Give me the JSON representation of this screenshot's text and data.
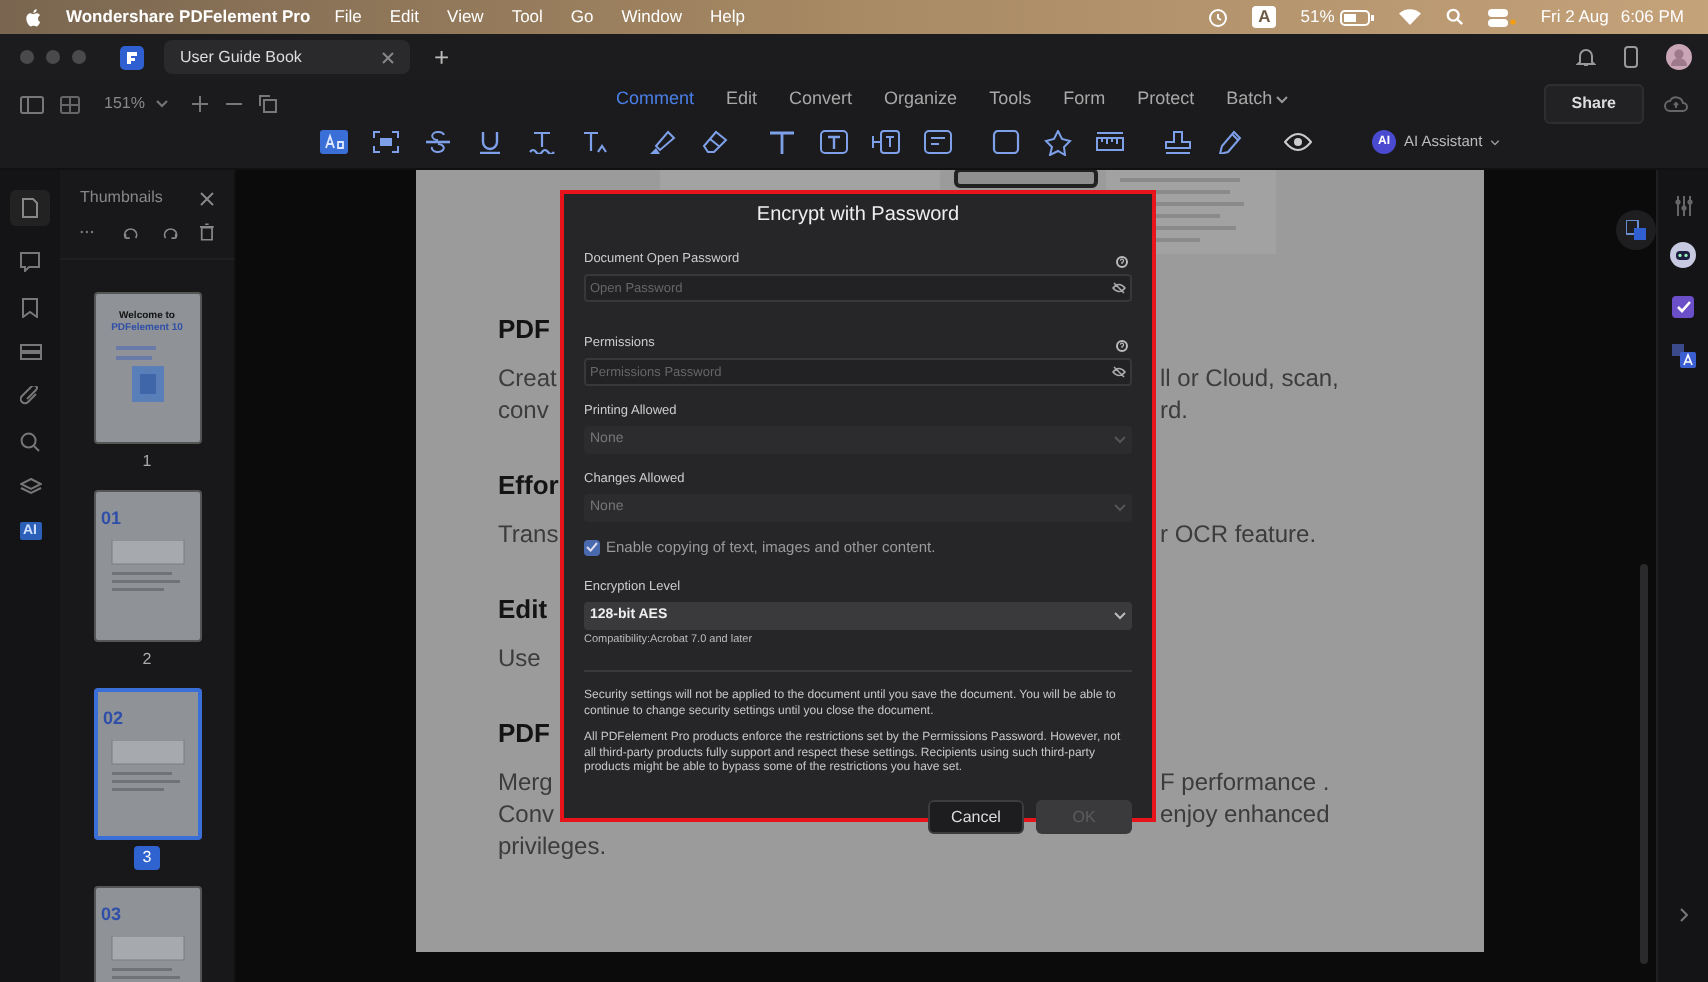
{
  "menu_bar": {
    "app_name": "Wondershare PDFelement Pro",
    "menus": [
      "File",
      "Edit",
      "View",
      "Tool",
      "Go",
      "Window",
      "Help"
    ],
    "input_source": "A",
    "battery": "51%",
    "date": "Fri 2 Aug",
    "time": "6:06 PM"
  },
  "tab_bar": {
    "tabs": [
      {
        "label": "User Guide Book",
        "selected": true
      }
    ],
    "new_tab": "+"
  },
  "toolbar": {
    "zoom": "151%",
    "modes": [
      {
        "label": "Comment",
        "selected": true
      },
      {
        "label": "Edit",
        "selected": false
      },
      {
        "label": "Convert",
        "selected": false
      },
      {
        "label": "Organize",
        "selected": false
      },
      {
        "label": "Tools",
        "selected": false
      },
      {
        "label": "Form",
        "selected": false
      },
      {
        "label": "Protect",
        "selected": false
      },
      {
        "label": "Batch",
        "selected": false
      }
    ],
    "share": "Share",
    "ai_badge": "AI",
    "ai_assistant": "AI Assistant"
  },
  "left_rail": {
    "ai_label": "AI"
  },
  "thumbnails": {
    "title": "Thumbnails",
    "pages": [
      {
        "number": "1",
        "selected": false,
        "lines": [
          "Welcome to",
          "PDFelement 10"
        ]
      },
      {
        "number": "2",
        "selected": false,
        "lines": [
          "01"
        ]
      },
      {
        "number": "3",
        "selected": true,
        "lines": [
          "02"
        ]
      },
      {
        "selected": false,
        "lines": [
          "03"
        ]
      }
    ]
  },
  "document": {
    "sections": [
      {
        "heading": "PDF",
        "lines": [
          {
            "left": "Creat",
            "right": "ll or Cloud, scan,"
          },
          {
            "left": "conv",
            "right": "rd."
          }
        ]
      },
      {
        "heading": "Effor",
        "lines": [
          {
            "left": "Trans",
            "right": "r OCR feature."
          }
        ]
      },
      {
        "heading": "Edit",
        "lines": [
          {
            "left": "Use"
          }
        ]
      },
      {
        "heading": "PDF",
        "lines": [
          {
            "left": "Merg",
            "right": "F performance ."
          },
          {
            "left": "Conv",
            "right": "enjoy enhanced"
          },
          {
            "left": "privileges."
          }
        ]
      }
    ]
  },
  "dialog": {
    "title": "Encrypt with Password",
    "fields": [
      {
        "kind": "password",
        "label": "Document Open Password",
        "placeholder": "Open Password"
      },
      {
        "kind": "password",
        "label": "Permissions",
        "placeholder": "Permissions Password"
      },
      {
        "kind": "select",
        "label": "Printing Allowed",
        "value": "None",
        "disabled": true
      },
      {
        "kind": "select",
        "label": "Changes Allowed",
        "value": "None",
        "disabled": true
      },
      {
        "kind": "checkbox",
        "label": "Enable copying of text, images and other content.",
        "checked": true
      },
      {
        "kind": "select",
        "label": "Encryption Level",
        "value": "128-bit AES",
        "disabled": false,
        "note": "Compatibility:Acrobat 7.0 and later"
      }
    ],
    "notes": [
      "Security settings will not be applied to the document until you save the document. You will be able to continue to change security settings until you close the document.",
      "All PDFelement Pro products enforce the restrictions set by the Permissions Password. However, not all third-party products fully support and respect these settings. Recipients using such third-party products might be able to bypass some of the restrictions you have set."
    ],
    "buttons": [
      {
        "label": "Cancel",
        "disabled": false
      },
      {
        "label": "OK",
        "disabled": true
      }
    ]
  }
}
